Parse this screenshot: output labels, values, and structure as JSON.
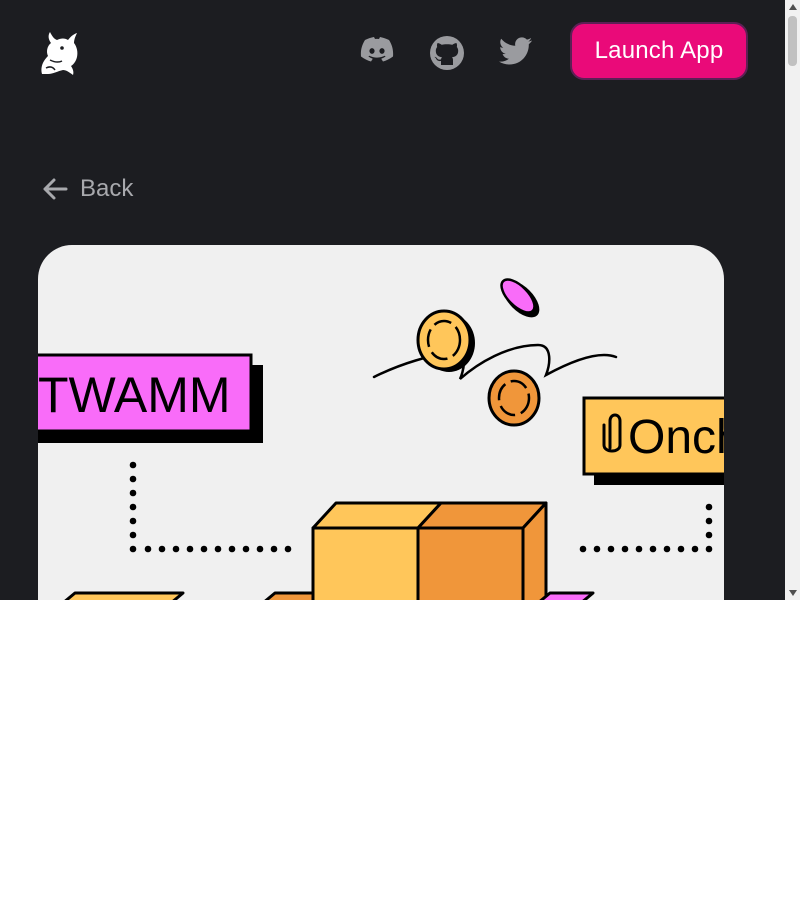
{
  "header": {
    "logo_icon": "uniswap-unicorn-icon",
    "social": [
      {
        "name": "discord",
        "icon": "discord-icon"
      },
      {
        "name": "github",
        "icon": "github-icon"
      },
      {
        "name": "twitter",
        "icon": "twitter-icon"
      }
    ],
    "launch_label": "Launch App"
  },
  "nav": {
    "back_label": "Back"
  },
  "hero": {
    "tag_left": "TWAMM",
    "tag_right": "Onch"
  },
  "colors": {
    "page_bg": "#1c1d21",
    "accent_pink": "#ea0a79",
    "magenta": "#f96cf9",
    "coin_yellow": "#ffc65a",
    "coin_orange": "#f0963a",
    "muted_text": "#a8a9ad"
  }
}
